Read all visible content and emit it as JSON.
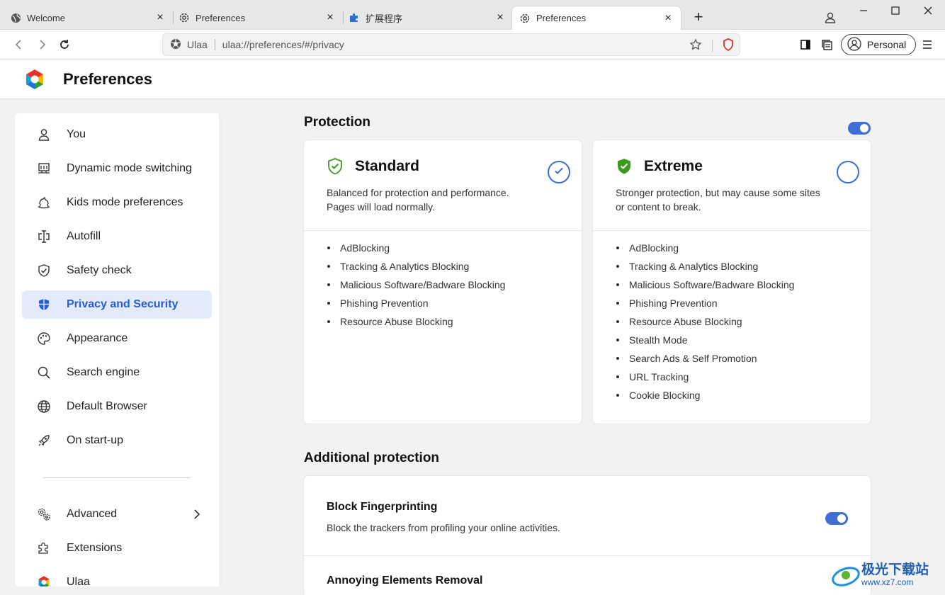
{
  "tabs": [
    {
      "label": "Welcome",
      "icon": "globe-icon"
    },
    {
      "label": "Preferences",
      "icon": "gear-icon"
    },
    {
      "label": "扩展程序",
      "icon": "puzzle-icon"
    },
    {
      "label": "Preferences",
      "icon": "gear-icon",
      "active": true
    }
  ],
  "toolbar": {
    "site_name": "Ulaa",
    "url": "ulaa://preferences/#/privacy",
    "profile_label": "Personal"
  },
  "header": {
    "title": "Preferences"
  },
  "sidebar": {
    "items": [
      {
        "label": "You",
        "icon": "person-icon"
      },
      {
        "label": "Dynamic mode switching",
        "icon": "monitor-icon"
      },
      {
        "label": "Kids mode preferences",
        "icon": "rocking-horse-icon"
      },
      {
        "label": "Autofill",
        "icon": "autofill-icon"
      },
      {
        "label": "Safety check",
        "icon": "shield-check-icon"
      },
      {
        "label": "Privacy and Security",
        "icon": "shield-icon",
        "active": true
      },
      {
        "label": "Appearance",
        "icon": "palette-icon"
      },
      {
        "label": "Search engine",
        "icon": "search-icon"
      },
      {
        "label": "Default Browser",
        "icon": "globe-icon"
      },
      {
        "label": "On start-up",
        "icon": "rocket-icon"
      }
    ],
    "bottom_items": [
      {
        "label": "Advanced",
        "icon": "gears-icon"
      },
      {
        "label": "Extensions",
        "icon": "puzzle-icon"
      },
      {
        "label": "Ulaa",
        "icon": "ulaa-logo-icon"
      }
    ]
  },
  "protection": {
    "title": "Protection",
    "enabled": true,
    "cards": [
      {
        "title": "Standard",
        "description": "Balanced for protection and performance. Pages will load normally.",
        "selected": true,
        "features": [
          "AdBlocking",
          "Tracking & Analytics Blocking",
          "Malicious Software/Badware Blocking",
          "Phishing Prevention",
          "Resource Abuse Blocking"
        ]
      },
      {
        "title": "Extreme",
        "description": "Stronger protection, but may cause some sites or content to break.",
        "selected": false,
        "features": [
          "AdBlocking",
          "Tracking & Analytics Blocking",
          "Malicious Software/Badware Blocking",
          "Phishing Prevention",
          "Resource Abuse Blocking",
          "Stealth Mode",
          "Search Ads & Self Promotion",
          "URL Tracking",
          "Cookie Blocking"
        ]
      }
    ]
  },
  "additional": {
    "title": "Additional protection",
    "rows": [
      {
        "title": "Block Fingerprinting",
        "description": "Block the trackers from profiling your online activities.",
        "enabled": true
      },
      {
        "title": "Annoying Elements Removal",
        "description": ""
      }
    ]
  },
  "watermark": {
    "text": "极光下载站",
    "url": "www.xz7.com"
  },
  "colors": {
    "accent": "#3d6fd6",
    "active_bg": "#e3ebfb",
    "shield_green": "#3c9a1f"
  }
}
